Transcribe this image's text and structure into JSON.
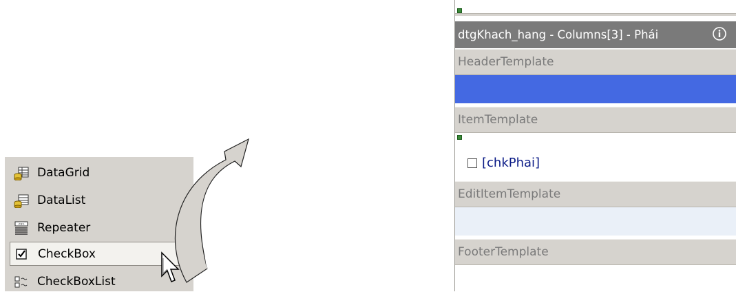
{
  "toolbox": {
    "items": [
      {
        "label": "DataGrid",
        "icon": "datagrid-icon"
      },
      {
        "label": "DataList",
        "icon": "datalist-icon"
      },
      {
        "label": "Repeater",
        "icon": "repeater-icon"
      },
      {
        "label": "CheckBox",
        "icon": "checkbox-icon",
        "selected": true
      },
      {
        "label": "CheckBoxList",
        "icon": "checkboxlist-icon"
      }
    ]
  },
  "designer": {
    "title": "dtgKhach_hang - Columns[3] - Phái",
    "sections": {
      "header": "HeaderTemplate",
      "item": "ItemTemplate",
      "edit_item": "EditItemTemplate",
      "footer": "FooterTemplate"
    },
    "checkbox_label": "[chkPhai]"
  },
  "colors": {
    "toolbox_bg": "#d6d3ce",
    "title_bg": "#7a7a7a",
    "header_fill": "#4469e2",
    "edit_fill": "#eaf0f8",
    "checkbox_text": "#0a1a86"
  }
}
